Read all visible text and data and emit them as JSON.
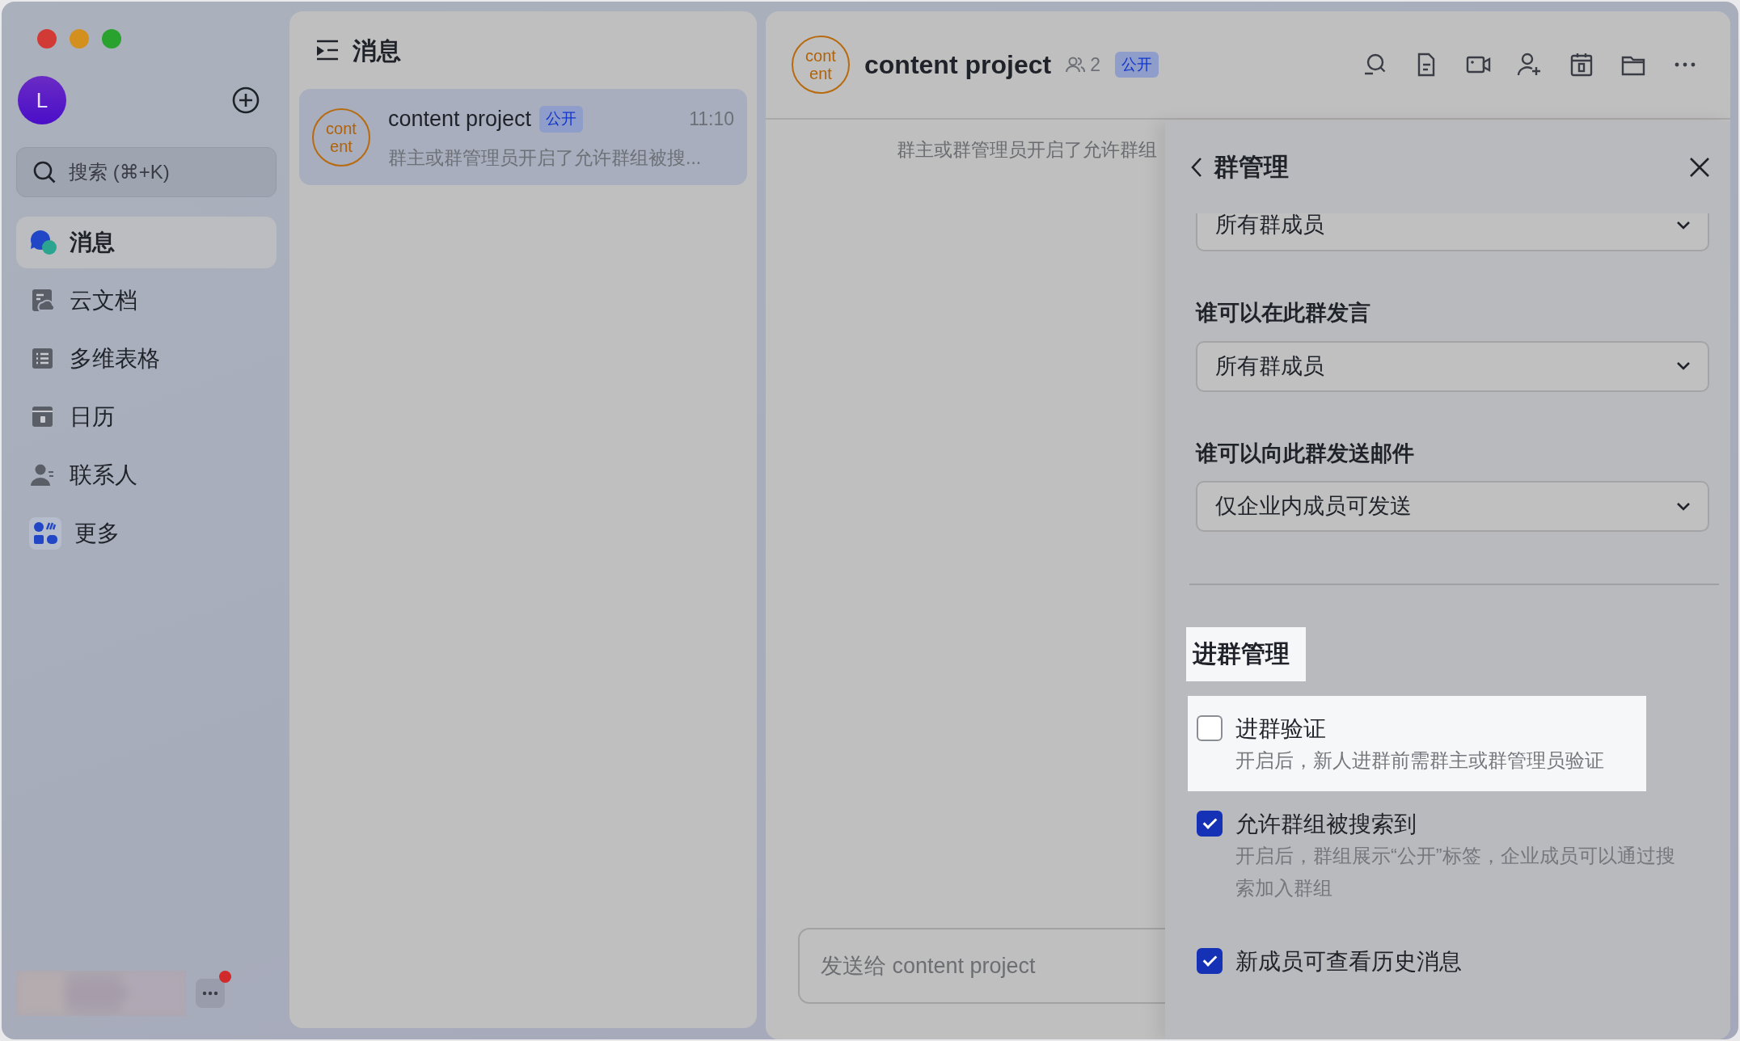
{
  "window": {
    "traffic_lights": [
      {
        "color": "#d23a36"
      },
      {
        "color": "#d4901f"
      },
      {
        "color": "#2aa22f"
      }
    ]
  },
  "user": {
    "avatar_initial": "L"
  },
  "sidebar": {
    "search": {
      "placeholder": "搜索 (⌘+K)"
    },
    "items": [
      {
        "kind": "messages",
        "label": "消息",
        "selected": true
      },
      {
        "kind": "docs",
        "label": "云文档",
        "selected": false
      },
      {
        "kind": "base",
        "label": "多维表格",
        "selected": false
      },
      {
        "kind": "calendar",
        "label": "日历",
        "selected": false
      },
      {
        "kind": "contacts",
        "label": "联系人",
        "selected": false
      },
      {
        "kind": "more",
        "label": "更多",
        "selected": false
      }
    ],
    "footer": {
      "unread_dot": true
    }
  },
  "chat_list": {
    "title": "消息",
    "chats": [
      {
        "avatar_lines": [
          "cont",
          "ent"
        ],
        "name": "content project",
        "badge": "公开",
        "time": "11:10",
        "preview": "群主或群管理员开启了允许群组被搜...",
        "selected": true
      }
    ]
  },
  "chat": {
    "avatar_lines": [
      "cont",
      "ent"
    ],
    "title": "content project",
    "member_count": "2",
    "badge": "公开",
    "toolbar": [
      {
        "kind": "search"
      },
      {
        "kind": "doc"
      },
      {
        "kind": "video"
      },
      {
        "kind": "add-member"
      },
      {
        "kind": "calendar"
      },
      {
        "kind": "folder"
      },
      {
        "kind": "more"
      }
    ],
    "system_message": "群主或群管理员开启了允许群组",
    "composer": {
      "placeholder": "发送给 content project"
    }
  },
  "group_admin_panel": {
    "title": "群管理",
    "settings": [
      {
        "value": "所有群成员"
      },
      {
        "label": "谁可以在此群发言",
        "value": "所有群成员"
      },
      {
        "label": "谁可以向此群发送邮件",
        "value": "仅企业内成员可发送"
      }
    ],
    "section": {
      "title": "进群管理",
      "highlighted": true
    },
    "options": [
      {
        "label": "进群验证",
        "description": "开启后，新人进群前需群主或群管理员验证",
        "checked": false,
        "highlighted": true
      },
      {
        "label": "允许群组被搜索到",
        "description": "开启后，群组展示“公开”标签，企业成员可以通过搜索加入群组",
        "checked": true,
        "highlighted": false
      },
      {
        "label": "新成员可查看历史消息",
        "checked": true,
        "highlighted": false
      }
    ]
  }
}
